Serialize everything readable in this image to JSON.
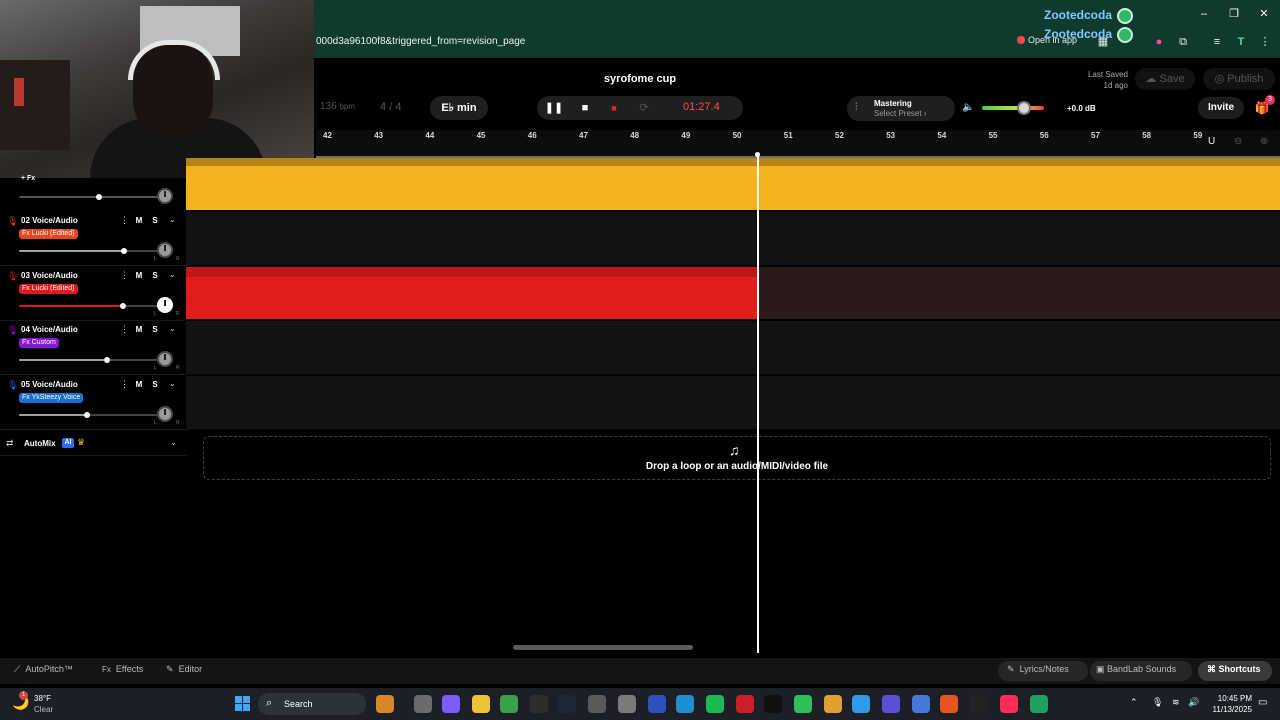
{
  "browser": {
    "url": "000d3a96100f8&triggered_from=revision_page",
    "open_in_app": "Open in app",
    "user1": "Zootedcoda",
    "user2": "Zootedcoda",
    "profile_letter": "T"
  },
  "header": {
    "project_title": "syrofome cup",
    "bpm_value": "136",
    "bpm_unit": "bpm",
    "time_sig_top": "4",
    "time_sig_sep": "/",
    "time_sig_bottom": "4",
    "key": "E♭ min",
    "time": "01:27.4",
    "mastering_label": "Mastering",
    "mastering_preset": "Select Preset",
    "volume_db": "+0.0 dB",
    "last_saved_label": "Last Saved",
    "last_saved_value": "1d ago",
    "save_label": "Save",
    "publish_label": "Publish",
    "invite_label": "Invite",
    "gift_badge": "3"
  },
  "ruler": [
    "42",
    "43",
    "44",
    "45",
    "46",
    "47",
    "48",
    "49",
    "50",
    "51",
    "52",
    "53",
    "54",
    "55",
    "56",
    "57",
    "58",
    "59"
  ],
  "tracks": [
    {
      "top_label": "+ Fx"
    },
    {
      "name": "02 Voice/Audio",
      "fx": "Fx Lucki (Edited)",
      "fx_color": "#e8461f",
      "slider_fill": "#a0a0a0",
      "mute": "M",
      "solo": "S"
    },
    {
      "name": "03 Voice/Audio",
      "fx": "Fx Lucki (Edited)",
      "fx_color": "#e31919",
      "slider_fill": "#e31919",
      "mute": "M",
      "solo": "S"
    },
    {
      "name": "04 Voice/Audio",
      "fx": "Fx Custom",
      "fx_color": "#8a16d6",
      "slider_fill": "#a0a0a0",
      "mute": "M",
      "solo": "S"
    },
    {
      "name": "05 Voice/Audio",
      "fx": "Fx YkSteezy Voice",
      "fx_color": "#1a6fd1",
      "slider_fill": "#a0a0a0",
      "mute": "M",
      "solo": "S"
    }
  ],
  "knob_labels": {
    "l": "L",
    "r": "R"
  },
  "automix": {
    "label": "AutoMix",
    "badge": "AI"
  },
  "drop_zone": "Drop a loop or an audio/MIDI/video file",
  "bottom_bar": {
    "autopitch": "AutoPitch™",
    "effects_prefix": "Fx",
    "effects": "Effects",
    "editor": "Editor",
    "lyrics": "Lyrics/Notes",
    "bandlab_sounds": "BandLab Sounds",
    "shortcuts": "Shortcuts"
  },
  "taskbar": {
    "temp": "38°F",
    "weather": "Clear",
    "search": "Search",
    "notif_badge": "1",
    "time": "10:45 PM",
    "date": "11/13/2025"
  }
}
